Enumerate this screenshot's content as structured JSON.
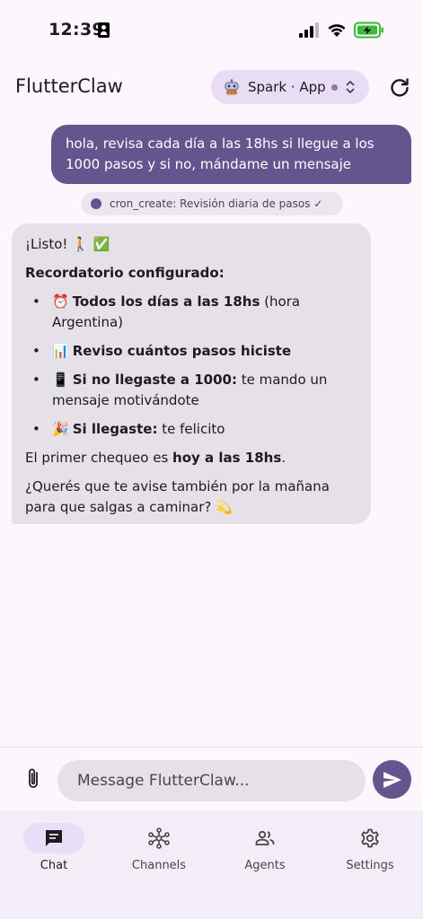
{
  "status_bar": {
    "time": "12:39",
    "icons": [
      "id-card-icon",
      "signal-icon",
      "wifi-icon",
      "battery-charging-icon"
    ]
  },
  "app_bar": {
    "title": "FlutterClaw",
    "model_chip": {
      "label": "Spark · App",
      "icon": "robot-icon",
      "status_color": "#8a7d98"
    },
    "refresh_icon": "refresh-icon"
  },
  "chat": {
    "user_message": "hola, revisa cada día a las 18hs si llegue a los 1000 pasos y si no, mándame un mensaje",
    "tool_call": "cron_create: Revisión diaria de pasos ✓",
    "assistant": {
      "greeting": "¡Listo! 🚶 ✅",
      "heading": "Recordatorio configurado:",
      "items": [
        {
          "emoji": "⏰",
          "bold": "Todos los días a las 18hs",
          "rest": " (hora Argentina)"
        },
        {
          "emoji": "📊",
          "bold": "Reviso cuántos pasos hiciste",
          "rest": ""
        },
        {
          "emoji": "📱",
          "bold": "Si no llegaste a 1000:",
          "rest": " te mando un mensaje motivándote"
        },
        {
          "emoji": "🎉",
          "bold": "Si llegaste:",
          "rest": " te felicito"
        }
      ],
      "first_check_prefix": "El primer chequeo es ",
      "first_check_bold": "hoy a las 18hs",
      "first_check_suffix": ".",
      "question": "¿Querés que te avise también por la mañana para que salgas a caminar? 💫"
    }
  },
  "composer": {
    "placeholder": "Message FlutterClaw...",
    "value": ""
  },
  "bottom_nav": {
    "items": [
      {
        "label": "Chat",
        "icon": "chat-icon",
        "active": true
      },
      {
        "label": "Channels",
        "icon": "hub-icon",
        "active": false
      },
      {
        "label": "Agents",
        "icon": "group-icon",
        "active": false
      },
      {
        "label": "Settings",
        "icon": "gear-icon",
        "active": false
      }
    ]
  },
  "colors": {
    "accent": "#65558f",
    "background": "#fdf7fd",
    "assistant_bubble": "#e6e0e9",
    "chip": "#e9dcf5",
    "nav_background": "#f3edf7"
  }
}
